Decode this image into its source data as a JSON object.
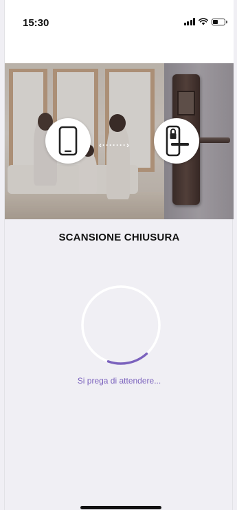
{
  "status_bar": {
    "time": "15:30",
    "icons": [
      "signal-icon",
      "wifi-icon",
      "battery-icon"
    ]
  },
  "hero": {
    "left_icon": "smartphone-icon",
    "connector": "dotted-double-arrow-icon",
    "right_icon": "door-lock-icon"
  },
  "screen": {
    "title": "SCANSIONE CHIUSURA",
    "spinner_progress": 0.17,
    "waiting_text": "Si prega di attendere..."
  },
  "colors": {
    "accent": "#7b62bd",
    "background": "#f0eff4",
    "spinner_track": "#ffffff"
  }
}
